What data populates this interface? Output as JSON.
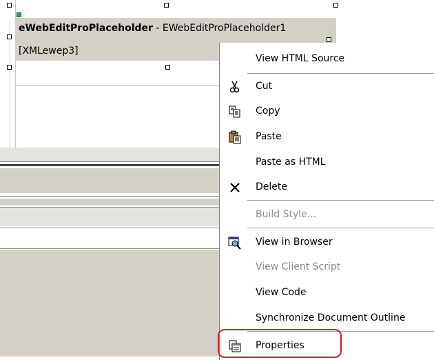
{
  "control": {
    "type_name": "eWebEditProPlaceholder",
    "separator": " - ",
    "instance_name": "EWebEditProPlaceholder1",
    "content_tag": "[XMLewep3]"
  },
  "context_menu": {
    "items": [
      {
        "label": "View HTML Source",
        "icon": "",
        "enabled": true
      },
      {
        "label": "Cut",
        "icon": "scissors-icon",
        "enabled": true
      },
      {
        "label": "Copy",
        "icon": "copy-icon",
        "enabled": true
      },
      {
        "label": "Paste",
        "icon": "paste-icon",
        "enabled": true
      },
      {
        "label": "Paste as HTML",
        "icon": "",
        "enabled": true
      },
      {
        "label": "Delete",
        "icon": "delete-x-icon",
        "enabled": true
      },
      {
        "label": "Build Style...",
        "icon": "",
        "enabled": false
      },
      {
        "label": "View in Browser",
        "icon": "browser-magnifier-icon",
        "enabled": true
      },
      {
        "label": "View Client Script",
        "icon": "",
        "enabled": false
      },
      {
        "label": "View Code",
        "icon": "",
        "enabled": true
      },
      {
        "label": "Synchronize Document Outline",
        "icon": "",
        "enabled": true
      },
      {
        "label": "Properties",
        "icon": "properties-icon",
        "enabled": true
      }
    ]
  },
  "colors": {
    "control_face": "#d4d0c8",
    "highlight_ring": "#e0181c",
    "disabled_text": "#8a8a8a"
  }
}
